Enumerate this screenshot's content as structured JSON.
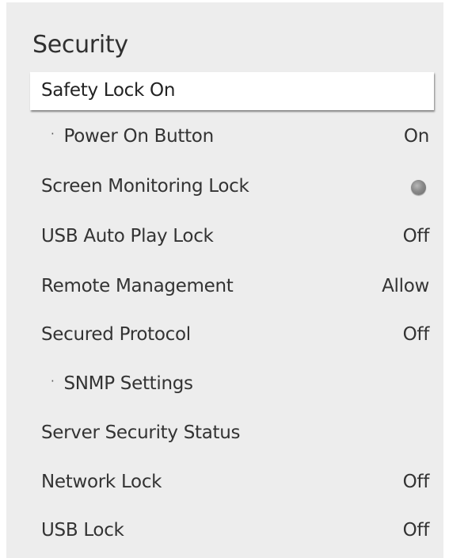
{
  "menu": {
    "title": "Security",
    "selected_item": {
      "label": "Safety Lock On"
    },
    "items": [
      {
        "label": "Power On Button",
        "value": "On",
        "sub": true
      },
      {
        "label": "Screen Monitoring Lock",
        "value": "",
        "toggle_state": "off"
      },
      {
        "label": "USB Auto Play Lock",
        "value": "Off"
      },
      {
        "label": "Remote Management",
        "value": "Allow"
      },
      {
        "label": "Secured Protocol",
        "value": "Off"
      },
      {
        "label": "SNMP Settings",
        "value": "",
        "sub": true
      },
      {
        "label": "Server Security Status",
        "value": ""
      },
      {
        "label": "Network Lock",
        "value": "Off"
      },
      {
        "label": "USB Lock",
        "value": "Off"
      }
    ]
  },
  "colors": {
    "panel_background": "#ededed",
    "selected_background": "#ffffff",
    "text": "#333333"
  },
  "icons": {
    "bullet": "·",
    "toggle": "radio-toggle-icon"
  }
}
